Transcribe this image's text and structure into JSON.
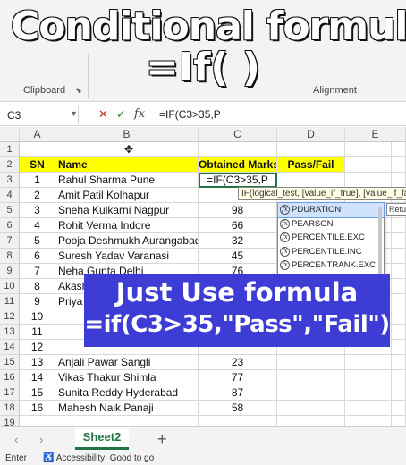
{
  "overlay": {
    "title_line1": "Conditional formula",
    "title_line2": "=If( )"
  },
  "ribbon": {
    "clipboard_label": "Clipboard",
    "alignment_label": "Alignment"
  },
  "formula_bar": {
    "cell_ref": "C3",
    "cancel_icon": "✕",
    "enter_icon": "✓",
    "fx_label": "fx",
    "formula": "=IF(C3>35,P"
  },
  "columns": [
    "A",
    "B",
    "C",
    "D",
    "E"
  ],
  "table": {
    "headers": [
      "SN",
      "Name",
      "Obtained Marks",
      "Pass/Fail"
    ],
    "rows": [
      {
        "sn": "1",
        "name": "Rahul Sharma Pune",
        "marks": "=IF(C3>35,P"
      },
      {
        "sn": "2",
        "name": "Amit Patil Kolhapur",
        "marks": ""
      },
      {
        "sn": "3",
        "name": "Sneha Kulkarni Nagpur",
        "marks": "98"
      },
      {
        "sn": "4",
        "name": "Rohit Verma Indore",
        "marks": "66"
      },
      {
        "sn": "5",
        "name": "Pooja Deshmukh Aurangabad",
        "marks": "32"
      },
      {
        "sn": "6",
        "name": "Suresh Yadav Varanasi",
        "marks": "45"
      },
      {
        "sn": "7",
        "name": "Neha Gupta Delhi",
        "marks": "76"
      },
      {
        "sn": "8",
        "name": "Akash",
        "marks": ""
      },
      {
        "sn": "9",
        "name": "Priya",
        "marks": ""
      },
      {
        "sn": "10",
        "name": "",
        "marks": ""
      },
      {
        "sn": "11",
        "name": "",
        "marks": ""
      },
      {
        "sn": "12",
        "name": "",
        "marks": ""
      },
      {
        "sn": "13",
        "name": "Anjali Pawar Sangli",
        "marks": "23"
      },
      {
        "sn": "14",
        "name": "Vikas Thakur Shimla",
        "marks": "77"
      },
      {
        "sn": "15",
        "name": "Sunita Reddy Hyderabad",
        "marks": "87"
      },
      {
        "sn": "16",
        "name": "Mahesh Naik Panaji",
        "marks": "58"
      }
    ]
  },
  "tooltip": {
    "text": "IF(logical_test, [value_if_true], [value_if_fa"
  },
  "return_tip": "Retu",
  "autocomplete": [
    {
      "label": "PDURATION"
    },
    {
      "label": "PEARSON"
    },
    {
      "label": "PERCENTILE.EXC"
    },
    {
      "label": "PERCENTILE.INC"
    },
    {
      "label": "PERCENTRANK.EXC"
    }
  ],
  "banner": {
    "line1": "Just Use formula",
    "line2": "=if(C3>35,\"Pass\",\"Fail\")"
  },
  "sheets": {
    "active_tab": "Sheet2",
    "add_icon": "+"
  },
  "status": {
    "mode": "Enter",
    "accessibility": "Accessibility: Good to go"
  },
  "colors": {
    "header_fill": "#ffff00",
    "excel_green": "#217346",
    "banner_blue": "#3d3dd6"
  }
}
